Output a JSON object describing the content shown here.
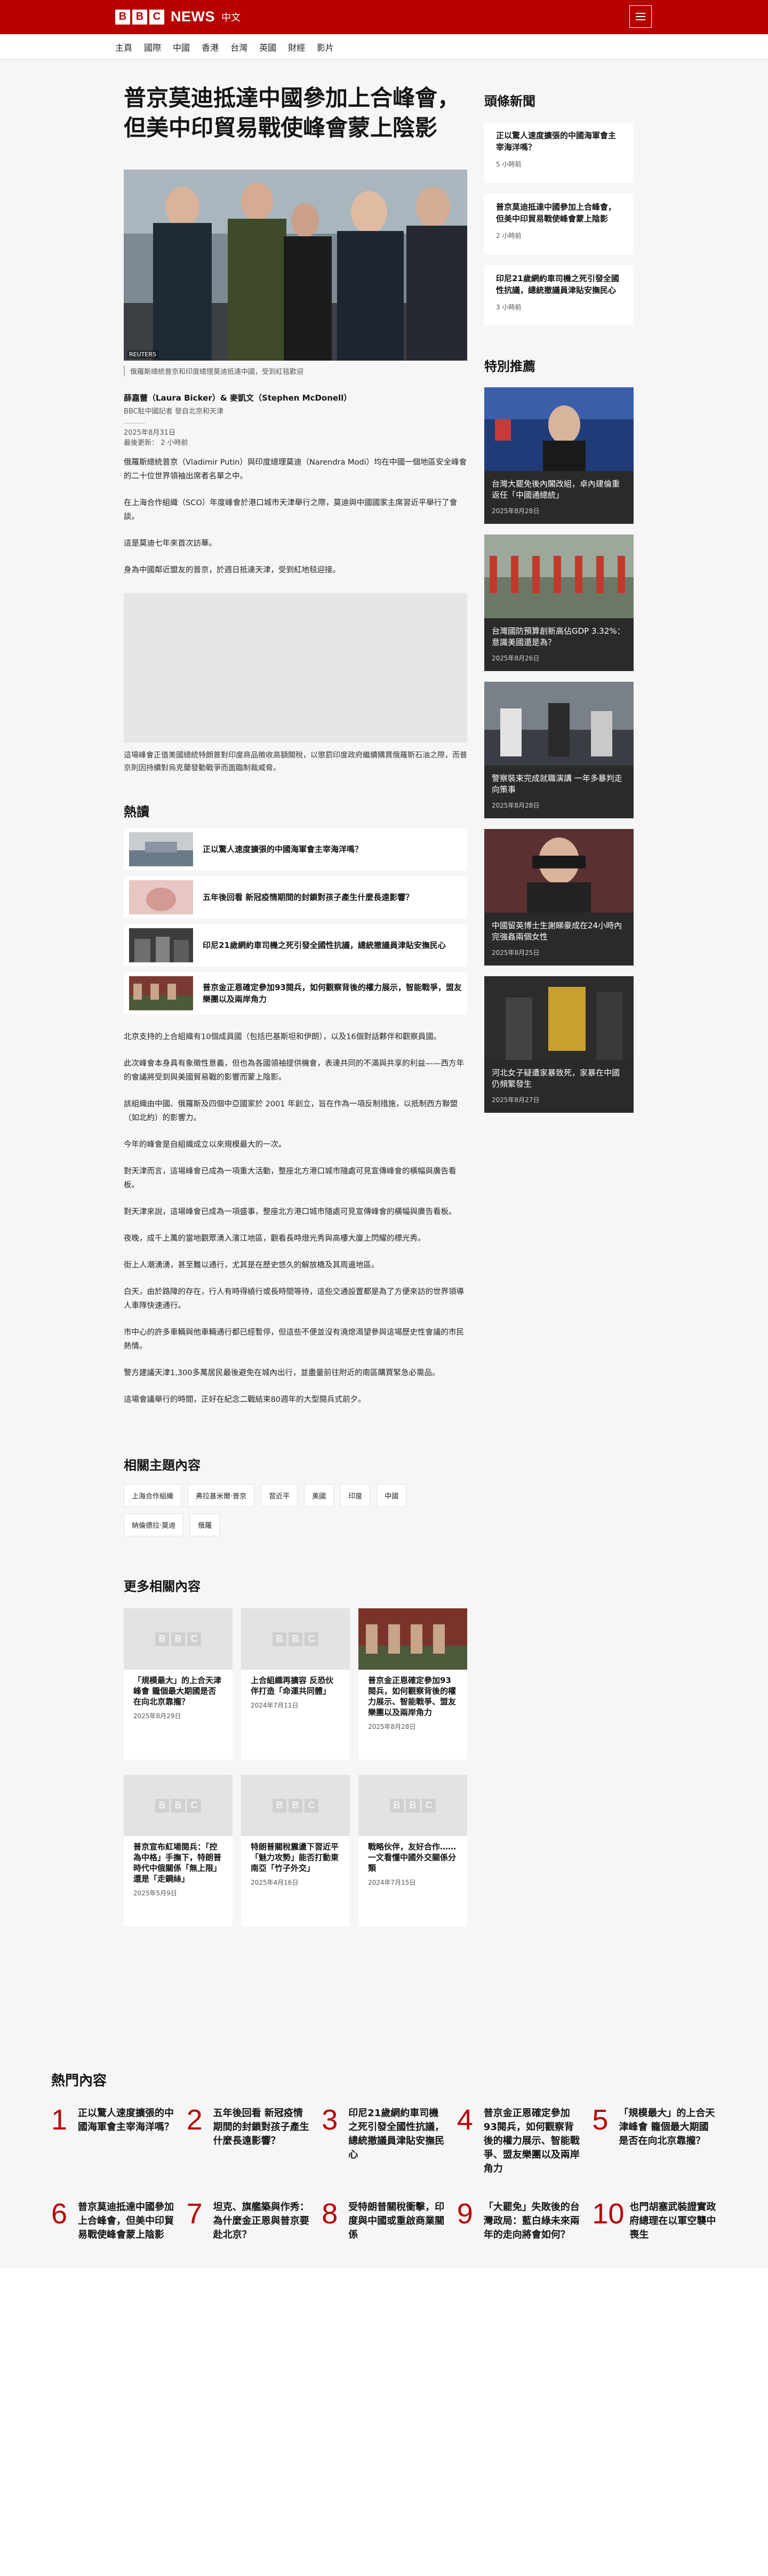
{
  "header": {
    "logo_letters": [
      "B",
      "B",
      "C"
    ],
    "logo_news": "NEWS",
    "logo_lang": "中文",
    "menu_icon": "hamburger-menu-icon"
  },
  "nav": [
    "主頁",
    "國際",
    "中國",
    "香港",
    "台灣",
    "英國",
    "財經",
    "影片"
  ],
  "article": {
    "headline": "普京莫迪抵達中國參加上合峰會，但美中印貿易戰使峰會蒙上陰影",
    "image_credit": "REUTERS",
    "image_caption": "俄羅斯總統普京和印度總理莫迪抵達中國，受到紅毯歡迎",
    "authors": "薛嘉蕾（Laura Bicker）& 麥凱文（Stephen McDonell）",
    "role": "BBC駐中國記者 發自北京和天津",
    "date": "2025年8月31日",
    "updated": "最後更新： 2 小時前",
    "paragraphs": [
      "俄羅斯總統普京（Vladimir Putin）與印度總理莫迪（Narendra Modi）均在中國一個地區安全峰會的二十位世界領袖出席者名單之中。",
      "在上海合作組織（SCO）年度峰會於港口城市天津舉行之際，莫迪與中國國家主席習近平舉行了會談。",
      "這是莫迪七年來首次訪華。",
      "身為中國鄰近盟友的普京，於週日抵達天津，受到紅地毯迎接。"
    ],
    "grey_caption": "這場峰會正值美國總統特朗普對印度商品徵收高額關稅，以懲罰印度政府繼續購買俄羅斯石油之際，而普京則因持續對烏克蘭發動戰爭而面臨制裁威脅。",
    "paragraphs2": [
      "北京支持的上合組織有10個成員國（包括巴基斯坦和伊朗），以及16個對話夥伴和觀察員國。",
      "此次峰會本身具有象徵性意義，但也為各國領袖提供機會，表達共同的不滿與共享的利益——西方年的會議將受到與美國貿易戰的影響而蒙上陰影。",
      "該組織由中國、俄羅斯及四個中亞國家於 2001 年創立，旨在作為一項反制措施，以抵制西方聯盟（如北約）的影響力。",
      "今年的峰會是自組織成立以來規模最大的一次。",
      "對天津而言，這場峰會已成為一項重大活動，整座北方港口城市隨處可見宣傳峰會的橫幅與廣告看板。",
      "對天津來說，這場峰會已成為一項盛事，整座北方港口城市隨處可見宣傳峰會的橫幅與廣告看板。",
      "夜晚，成千上萬的當地觀眾湧入濱江地區，觀看長時燈光秀與高樓大廈上閃耀的標光秀。",
      "街上人潮湧湧，甚至難以通行，尤其是在歷史悠久的解放橋及其周邊地區。",
      "白天，由於路障的存在，行人有時得繞行或長時間等待，這些交通設置都是為了方便來訪的世界領導人車隊快速通行。",
      "市中心的許多車輛與他車輛通行都已經暫停，但這些不便並沒有澆熄渴望參與這場歷史性會議的市民熱情。",
      "警方建議天津1,300多萬居民最後避免在城內出行，並盡量前往附近的南區購買緊急必需品。",
      "這場會議舉行的時間，正好在紀念二戰結束80週年的大型閱兵式前夕。"
    ]
  },
  "hot": {
    "title": "熱讀",
    "items": [
      "正以驚人速度擴張的中國海軍會主宰海洋嗎？",
      "五年後回看 新冠疫情期間的封鎖對孩子產生什麼長遠影響？",
      "印尼21歲網約車司機之死引發全國性抗議，總統撤議員津貼安撫民心",
      "普京金正恩確定參加93閱兵，如何觀察背後的權力展示，智能戰爭，盟友樂團以及兩岸角力"
    ]
  },
  "tags": {
    "title": "相關主題內容",
    "items": [
      "上海合作組織",
      "弗拉基米爾·普京",
      "習近平",
      "美國",
      "印度",
      "中國",
      "納倫德拉·莫迪",
      "俄羅"
    ]
  },
  "more": {
    "title": "更多相關內容",
    "logo_letters": [
      "B",
      "B",
      "C"
    ],
    "items": [
      {
        "title": "「規模最大」的上合天津峰會 籠個最大期國是否在向北京靠攏？",
        "date": "2025年8月29日"
      },
      {
        "title": "上合組織再擴容 反恐伙伴打造「命運共同體」",
        "date": "2024年7月11日"
      },
      {
        "title": "普京金正恩確定參加93閱兵，如何觀察背後的權力展示、智能戰爭、盟友樂團以及兩岸角力",
        "date": "2025年8月28日"
      },
      {
        "title": "普京宣布紅場閱兵：「控為中格」手撫下，特朗普時代中俄關係「無上限」還是「走鋼絲」",
        "date": "2025年5月9日"
      },
      {
        "title": "特朗普關稅震盪下習近平「魅力攻勢」能否打動東南亞「竹子外交」",
        "date": "2025年4月16日"
      },
      {
        "title": "戰略伙伴，友好合作……一文看懂中國外交關係分類",
        "date": "2024年7月15日"
      }
    ]
  },
  "sidebar": {
    "top_title": "頭條新聞",
    "top": [
      {
        "title": "正以驚人速度擴張的中國海軍會主宰海洋嗎？",
        "time": "5 小時前"
      },
      {
        "title": "普京莫迪抵達中國參加上合峰會，但美中印貿易戰使峰會蒙上陰影",
        "time": "2 小時前"
      },
      {
        "title": "印尼21歲網約車司機之死引發全國性抗議，總統撤議員津貼安撫民心",
        "time": "3 小時前"
      }
    ],
    "feat_title": "特別推薦",
    "feat": [
      {
        "title": "台灣大罷免後內閣改組，卓內建倫重返任「中國通總統」",
        "date": "2025年8月28日"
      },
      {
        "title": "台灣國防預算創新高佔GDP 3.32%：意識美國還是為？",
        "date": "2025年8月26日"
      },
      {
        "title": "警察裝束完成就職演講 一年多暴判走向策事",
        "date": "2025年8月28日"
      },
      {
        "title": "中國留英博士生謝睇豪成在24小時內完強姦兩個女性",
        "date": "2025年8月25日"
      },
      {
        "title": "河北女子疑遭家暴致死，家暴在中國仍頻繁發生",
        "date": "2025年8月27日"
      }
    ]
  },
  "most_read": {
    "title": "熱門內容",
    "items": [
      {
        "n": "1",
        "t": "正以驚人速度擴張的中國海軍會主宰海洋嗎？"
      },
      {
        "n": "2",
        "t": "五年後回看 新冠疫情期間的封鎖對孩子產生什麼長遠影響？"
      },
      {
        "n": "3",
        "t": "印尼21歲網約車司機之死引發全國性抗議，總統撤議員津貼安撫民心"
      },
      {
        "n": "4",
        "t": "普京金正恩確定參加93閱兵，如何觀察背後的權力展示、智能戰爭、盟友樂團以及兩岸角力"
      },
      {
        "n": "5",
        "t": "「規模最大」的上合天津峰會 籠個最大期國是否在向北京靠攏？"
      },
      {
        "n": "6",
        "t": "普京莫迪抵達中國參加上合峰會，但美中印貿易戰使峰會蒙上陰影"
      },
      {
        "n": "7",
        "t": "坦克、旗艦築與作秀：為什麼金正恩與普京要赴北京？"
      },
      {
        "n": "8",
        "t": "受特朗普關稅衝擊，印度與中國或重啟商業關係"
      },
      {
        "n": "9",
        "t": "「大罷免」失敗後的台灣政局：藍白綠未來兩年的走向將會如何？"
      },
      {
        "n": "10",
        "t": "也門胡塞武裝證實政府總理在以軍空襲中喪生"
      }
    ]
  }
}
